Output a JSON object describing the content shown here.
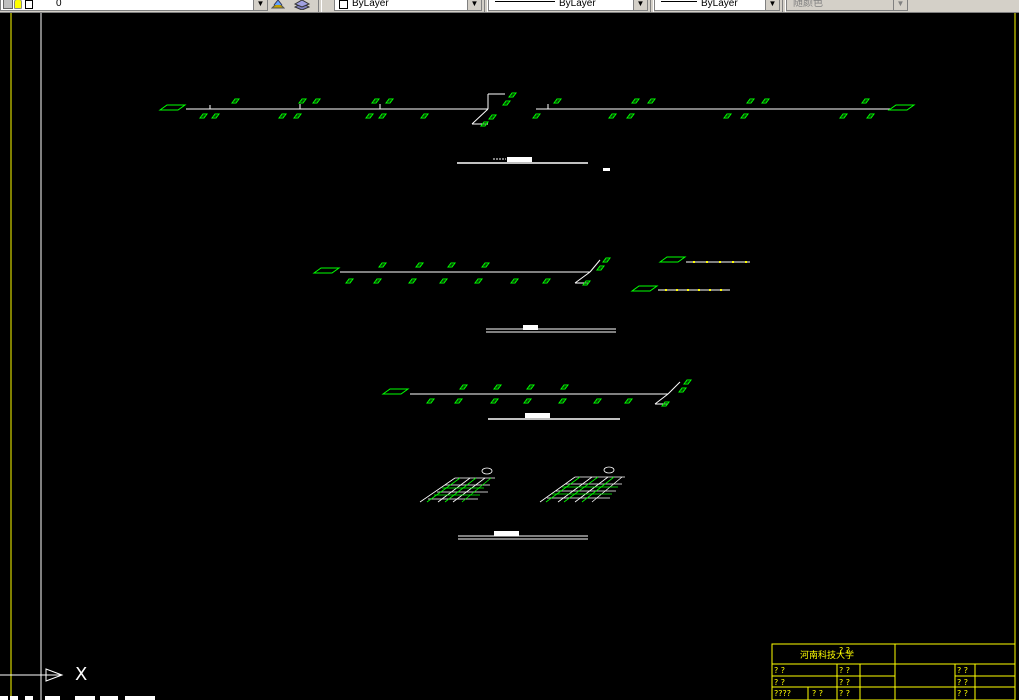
{
  "toolbar": {
    "layer_value": "0",
    "color_value": "ByLayer",
    "linetype_value": "ByLayer",
    "lineweight_value": "ByLayer",
    "plotstyle_value": "随颜色",
    "dropdown_arrow": "▼"
  },
  "ucs": {
    "axis_label": "X"
  },
  "title_block": {
    "school": "河南科技大学",
    "cells": [
      "? ?",
      "? ?",
      "? ?",
      "? ?",
      "? ?",
      "? ?",
      "? ?",
      "? ?",
      "????",
      "? ?",
      "? ?",
      "? ?",
      "? ?"
    ]
  },
  "colors": {
    "background": "#000000",
    "pipe": "#ffffff",
    "fixture": "#00ff00",
    "border": "#ffff00",
    "titleblock_text": "#ffff00",
    "toolbar": "#d4d0c8"
  },
  "icons": [
    "layer-state-icon",
    "layer-bulb-icon",
    "layer-sun-icon",
    "layer-lock-icon",
    "layer-color-icon",
    "layer-manager-icon",
    "layer-previous-icon"
  ]
}
